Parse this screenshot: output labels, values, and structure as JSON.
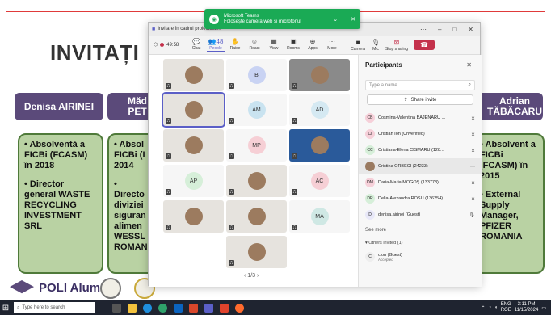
{
  "slide": {
    "title": "INVITAȚI",
    "footer_brand": "POLI Alumni",
    "guests": [
      {
        "name": "Denisa AIRINEI",
        "bullets": [
          "• Absolventă a FICBi (FCASM) în 2018",
          "• Director general WASTE RECYCLING INVESTMENT SRL"
        ]
      },
      {
        "name": "Măd PET",
        "bullets": [
          "• Absol FICBi (I 2014",
          "• Directo diviziei siguran alimen WESSL ROMAN"
        ]
      },
      {
        "name": "Adrian TĂBĂCARU",
        "bullets": [
          "• Absolvent a FICBi (FCASM) în 2015",
          "• External Supply Manager, PFIZER ROMANIA"
        ]
      }
    ]
  },
  "toast": {
    "app": "Microsoft Teams",
    "message": "Folosește camera web și microfonul"
  },
  "teams": {
    "window_title": "Invitare în cadrul proiectului...",
    "timer": "49:58",
    "tools": [
      {
        "label": "Chat",
        "icon": "chat-icon",
        "glyph": "💬"
      },
      {
        "label": "People",
        "icon": "people-icon",
        "glyph": "👥",
        "count": "48"
      },
      {
        "label": "Raise",
        "icon": "hand-icon",
        "glyph": "✋"
      },
      {
        "label": "React",
        "icon": "react-icon",
        "glyph": "☺"
      },
      {
        "label": "View",
        "icon": "view-icon",
        "glyph": "▦"
      },
      {
        "label": "Rooms",
        "icon": "rooms-icon",
        "glyph": "▣"
      },
      {
        "label": "Apps",
        "icon": "apps-icon",
        "glyph": "⊕"
      },
      {
        "label": "More",
        "icon": "more-icon",
        "glyph": "⋯"
      }
    ],
    "camera_label": "Camera",
    "mic_label": "Mic",
    "stop_sharing_label": "Stop sharing",
    "pager": "1/3",
    "tiles": [
      {
        "initials": "",
        "kind": "photo"
      },
      {
        "initials": "B",
        "kind": "initials",
        "color": "#c9d3f3"
      },
      {
        "initials": "",
        "kind": "photo"
      },
      {
        "initials": "",
        "kind": "photo"
      },
      {
        "initials": "AM",
        "kind": "initials",
        "color": "#c9e3f0"
      },
      {
        "initials": "AD",
        "kind": "initials",
        "color": "#d5e9f2"
      },
      {
        "initials": "",
        "kind": "photo"
      },
      {
        "initials": "MP",
        "kind": "initials",
        "color": "#f6cfd5"
      },
      {
        "initials": "",
        "kind": "photo"
      },
      {
        "initials": "AP",
        "kind": "initials",
        "color": "#d6efd9"
      },
      {
        "initials": "",
        "kind": "photo"
      },
      {
        "initials": "AC",
        "kind": "initials",
        "color": "#f6cfd5"
      },
      {
        "initials": "",
        "kind": "photo"
      },
      {
        "initials": "",
        "kind": "photo"
      },
      {
        "initials": "MA",
        "kind": "initials",
        "color": "#cfe8e4"
      },
      {
        "initials": "",
        "kind": "photo"
      }
    ]
  },
  "participants": {
    "title": "Participants",
    "search_placeholder": "Type a name",
    "share_invite": "Share invite",
    "list": [
      {
        "initials": "CB",
        "name": "Cosmina-Valentina BĂJENARU ...",
        "color": "#f6d0d9"
      },
      {
        "initials": "CI",
        "name": "Cristian Ion (Unverified)",
        "color": "#f6d0d9"
      },
      {
        "initials": "CC",
        "name": "Cristiana-Elena CISMARU (128...",
        "color": "#d6efd9"
      },
      {
        "initials": "",
        "name": "Cristina ORBECI (24233)",
        "color": "#9a7a60"
      },
      {
        "initials": "DM",
        "name": "Daria-Maria MOGOȘ (133778)",
        "color": "#f6d0d9"
      },
      {
        "initials": "DR",
        "name": "Delia-Alexandra ROȘU (136254)",
        "color": "#d6efd9"
      },
      {
        "initials": "D",
        "name": "denisa.airinei (Guest)",
        "color": "#e8e8f8"
      }
    ],
    "see_more": "See more",
    "others_invited": "Others invited (1)",
    "invited": {
      "initials": "C",
      "name": "cion (Guest)",
      "status": "Accepted"
    }
  },
  "taskbar": {
    "search_placeholder": "Type here to search",
    "lang": "ENG",
    "locale": "ROE",
    "time": "3:11 PM",
    "date": "11/15/2024"
  }
}
